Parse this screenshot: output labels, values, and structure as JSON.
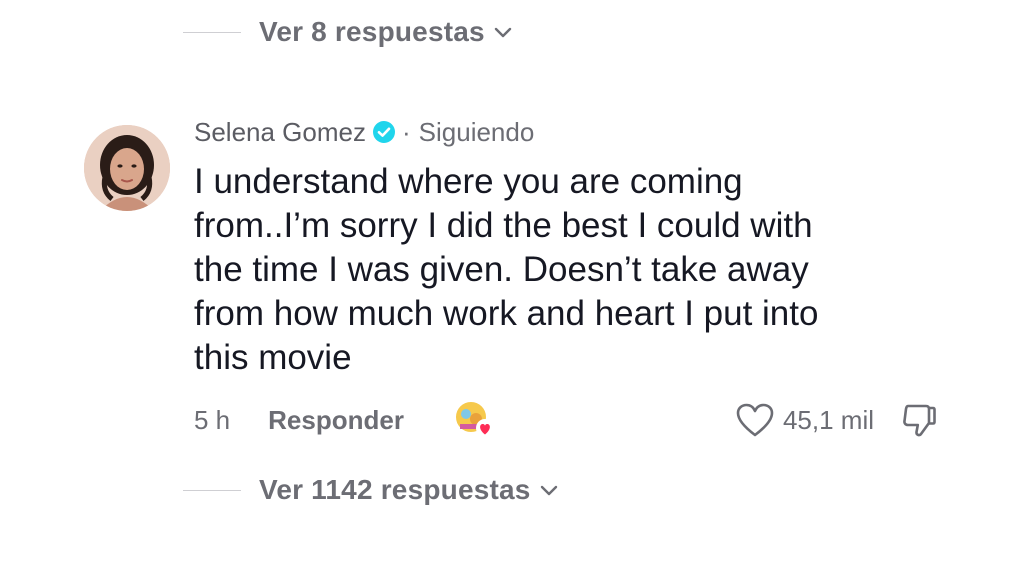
{
  "replies_top": {
    "label": "Ver 8 respuestas"
  },
  "comment": {
    "username": "Selena Gomez",
    "separator": "·",
    "follow_status": "Siguiendo",
    "text": "I understand where you are coming\nfrom..I’m sorry I did the best I could with\nthe time I was given. Doesn’t take away\nfrom how much work and heart I put into\nthis movie",
    "time": "5 h",
    "reply_label": "Responder",
    "like_count": "45,1 mil"
  },
  "replies_bottom": {
    "label": "Ver 1142 respuestas"
  },
  "icons": {
    "verified": "verified-badge-icon",
    "like": "heart-outline-icon",
    "dislike": "thumbs-down-icon",
    "chevron": "chevron-down-icon",
    "creator_liked": "creator-liked-avatar-icon"
  },
  "colors": {
    "verified": "#20d5ec",
    "muted_text": "#6c6d74",
    "body_text": "#161823",
    "heart_badge": "#fe2c55"
  }
}
